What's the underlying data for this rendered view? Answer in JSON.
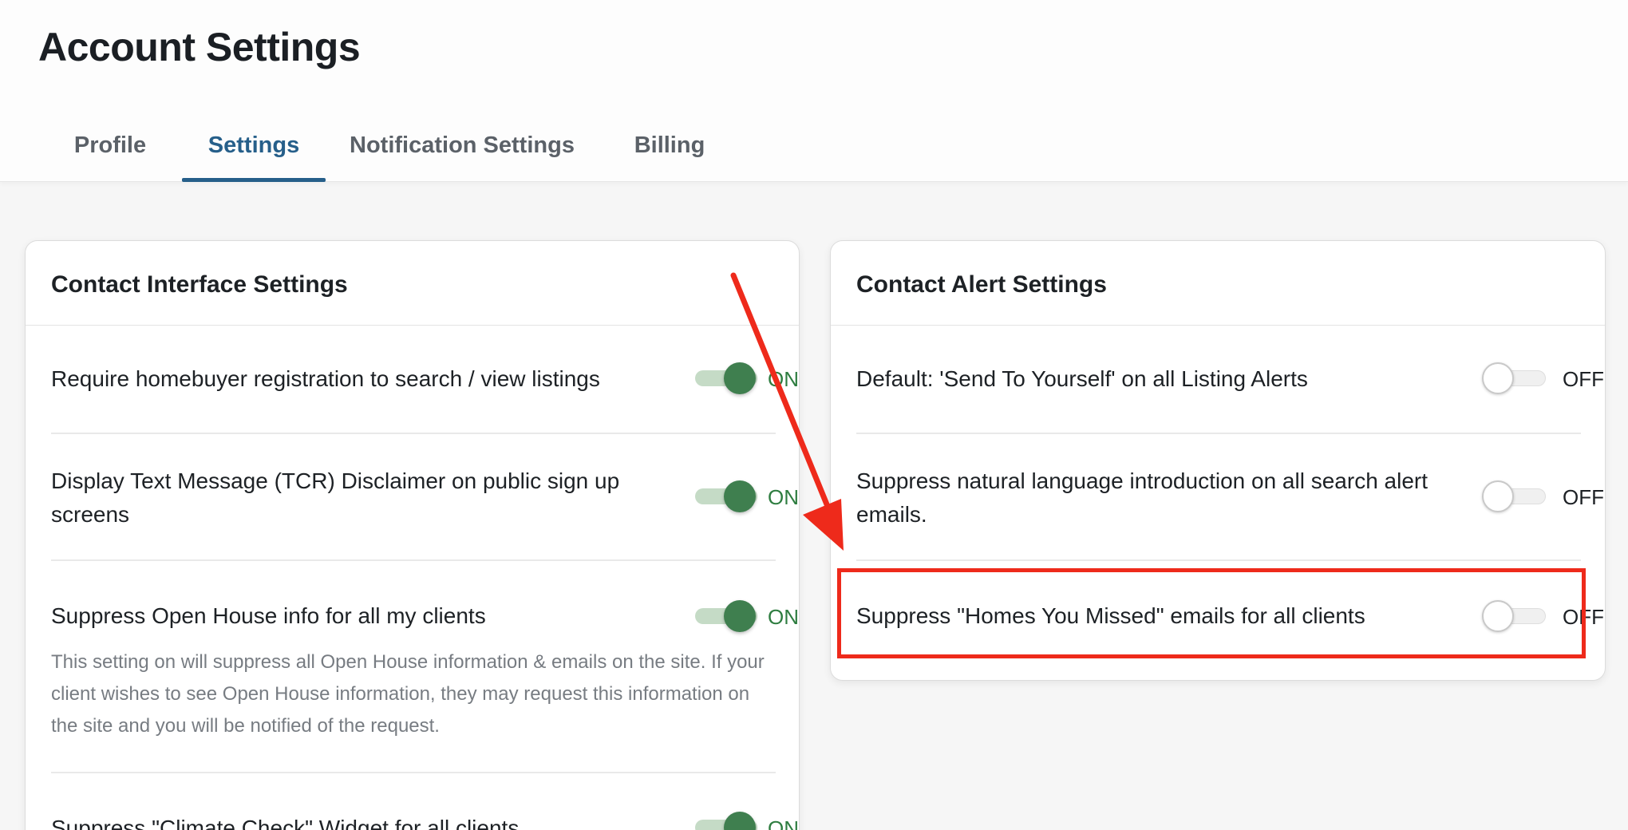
{
  "header": {
    "title": "Account Settings",
    "tabs": [
      {
        "label": "Profile",
        "active": false
      },
      {
        "label": "Settings",
        "active": true
      },
      {
        "label": "Notification Settings",
        "active": false
      },
      {
        "label": "Billing",
        "active": false
      }
    ]
  },
  "contact_interface": {
    "title": "Contact Interface Settings",
    "rows": [
      {
        "label": "Require homebuyer registration to search / view listings",
        "state": "ON",
        "enabled": true
      },
      {
        "label": "Display Text Message (TCR) Disclaimer on public sign up screens",
        "state": "ON",
        "enabled": true
      },
      {
        "label": "Suppress Open House info for all my clients",
        "state": "ON",
        "enabled": true,
        "description": "This setting on will suppress all Open House information & emails on the site. If your client wishes to see Open House information, they may request this information on the site and you will be notified of the request."
      },
      {
        "label": "Suppress \"Climate Check\" Widget for all clients",
        "state": "ON",
        "enabled": true
      }
    ]
  },
  "contact_alert": {
    "title": "Contact Alert Settings",
    "rows": [
      {
        "label": "Default: 'Send To Yourself' on all Listing Alerts",
        "state": "OFF",
        "enabled": false
      },
      {
        "label": "Suppress natural language introduction on all search alert emails.",
        "state": "OFF",
        "enabled": false
      },
      {
        "label": "Suppress \"Homes You Missed\" emails for all clients",
        "state": "OFF",
        "enabled": false
      }
    ]
  },
  "colors": {
    "accent": "#265f8a",
    "toggle_on": "#3f7f4f",
    "annotation_red": "#ee2a1b"
  }
}
